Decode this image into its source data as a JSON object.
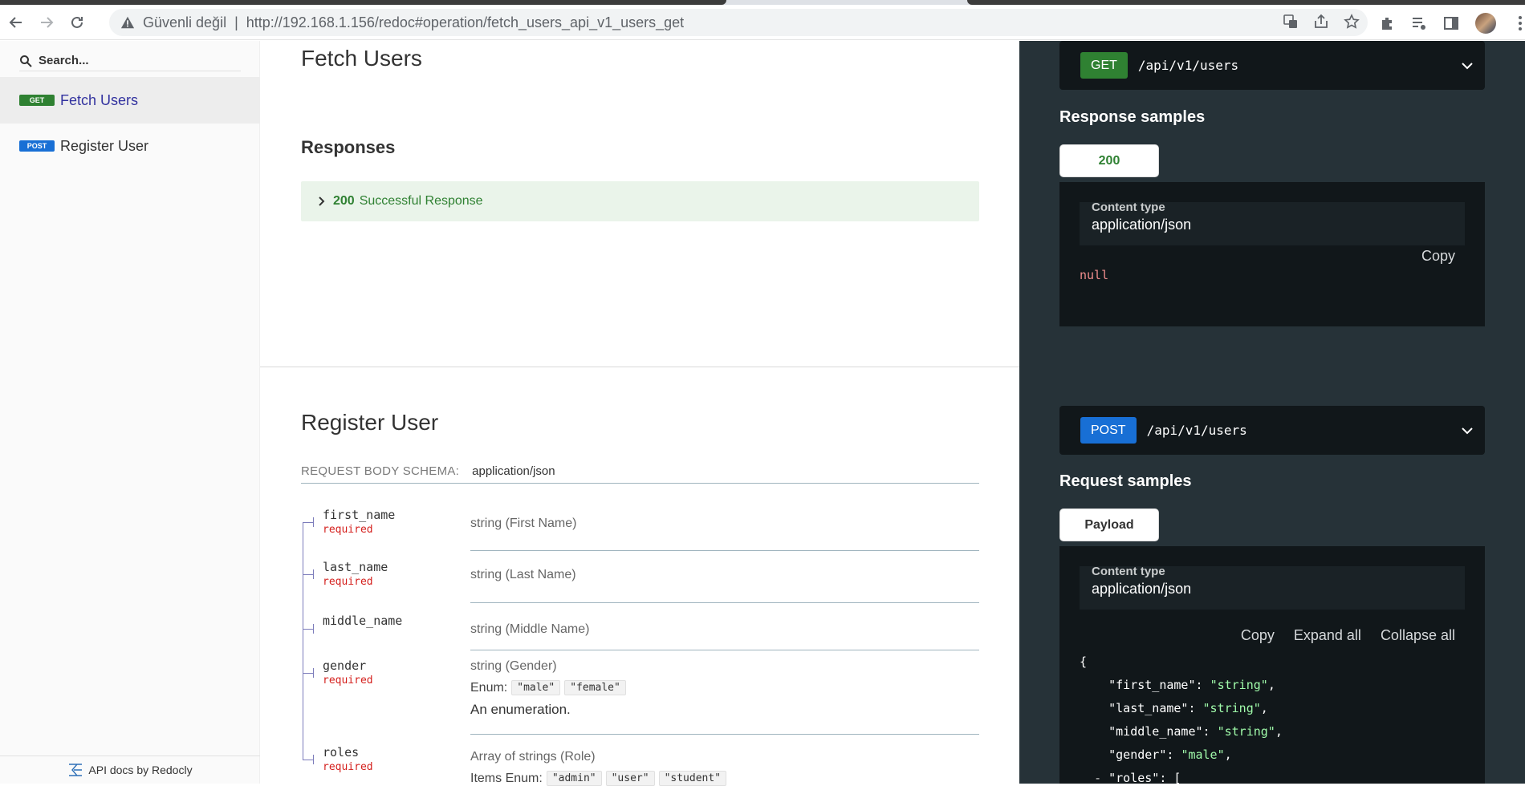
{
  "browser": {
    "security_label": "Güvenli değil",
    "separator": "|",
    "url": "http://192.168.1.156/redoc#operation/fetch_users_api_v1_users_get"
  },
  "sidebar": {
    "search_placeholder": "Search...",
    "items": [
      {
        "method": "GET",
        "label": "Fetch Users"
      },
      {
        "method": "POST",
        "label": "Register User"
      }
    ],
    "footer": "API docs by Redocly"
  },
  "fetch": {
    "title": "Fetch Users",
    "responses_heading": "Responses",
    "response_code": "200",
    "response_text": "Successful Response"
  },
  "register": {
    "title": "Register User",
    "schema_label": "REQUEST BODY SCHEMA:",
    "schema_value": "application/json",
    "fields": [
      {
        "name": "first_name",
        "required": "required",
        "type": "string (First Name)"
      },
      {
        "name": "last_name",
        "required": "required",
        "type": "string (Last Name)"
      },
      {
        "name": "middle_name",
        "required": "",
        "type": "string (Middle Name)"
      },
      {
        "name": "gender",
        "required": "required",
        "type": "string (Gender)",
        "enum_label": "Enum:",
        "enum": [
          "\"male\"",
          "\"female\""
        ],
        "note": "An enumeration."
      },
      {
        "name": "roles",
        "required": "required",
        "type": "Array of strings (Role)",
        "enum_label": "Items Enum:",
        "enum": [
          "\"admin\"",
          "\"user\"",
          "\"student\""
        ]
      }
    ]
  },
  "right": {
    "get_endpoint": {
      "method": "GET",
      "path": "/api/v1/users"
    },
    "response_samples_heading": "Response samples",
    "response_tab": "200",
    "content_type_label": "Content type",
    "content_type_value": "application/json",
    "copy_label": "Copy",
    "null_value": "null",
    "post_endpoint": {
      "method": "POST",
      "path": "/api/v1/users"
    },
    "request_samples_heading": "Request samples",
    "request_tab": "Payload",
    "expand_label": "Expand all",
    "collapse_label": "Collapse all",
    "payload_lines": [
      {
        "key": "\"first_name\"",
        "value": "\"string\""
      },
      {
        "key": "\"last_name\"",
        "value": "\"string\""
      },
      {
        "key": "\"middle_name\"",
        "value": "\"string\""
      },
      {
        "key": "\"gender\"",
        "value": "\"male\""
      }
    ],
    "roles_key": "\"roles\"",
    "open_brace": "{",
    "open_bracket": "[",
    "toggle": "-"
  },
  "colors": {
    "get": "#2f8132",
    "post": "#186fd5",
    "panel": "#263238",
    "code_bg": "#11171a",
    "link_active": "#32329f",
    "required": "#d41f1c"
  }
}
